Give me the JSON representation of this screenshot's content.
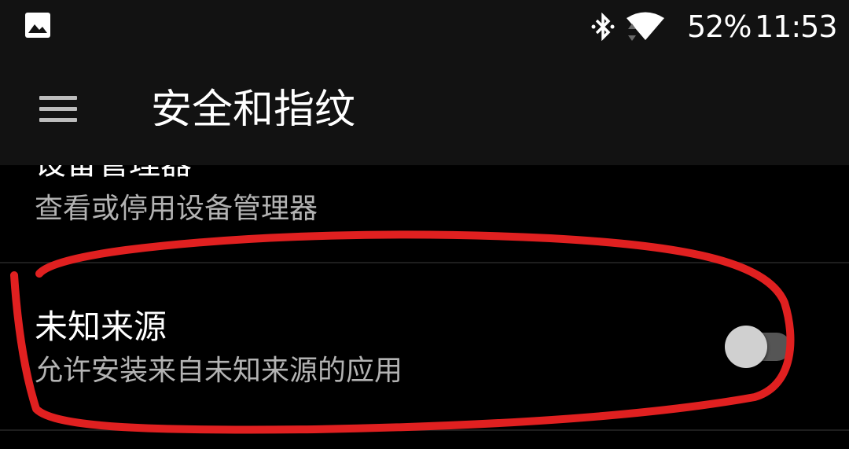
{
  "status_bar": {
    "icons": [
      "gallery-icon",
      "bluetooth-icon",
      "wifi-icon"
    ],
    "battery": "52%",
    "time": "11:53"
  },
  "toolbar": {
    "menu_icon": "hamburger-menu-icon",
    "title": "安全和指纹"
  },
  "settings": {
    "device_admin": {
      "title": "设备管理器",
      "summary": "查看或停用设备管理器"
    },
    "unknown_sources": {
      "title": "未知来源",
      "summary": "允许安装来自未知来源的应用",
      "enabled": false
    }
  },
  "colors": {
    "background": "#000000",
    "toolbar": "#121212",
    "summary_text": "#b3b3b3",
    "annotation": "#e02020"
  }
}
